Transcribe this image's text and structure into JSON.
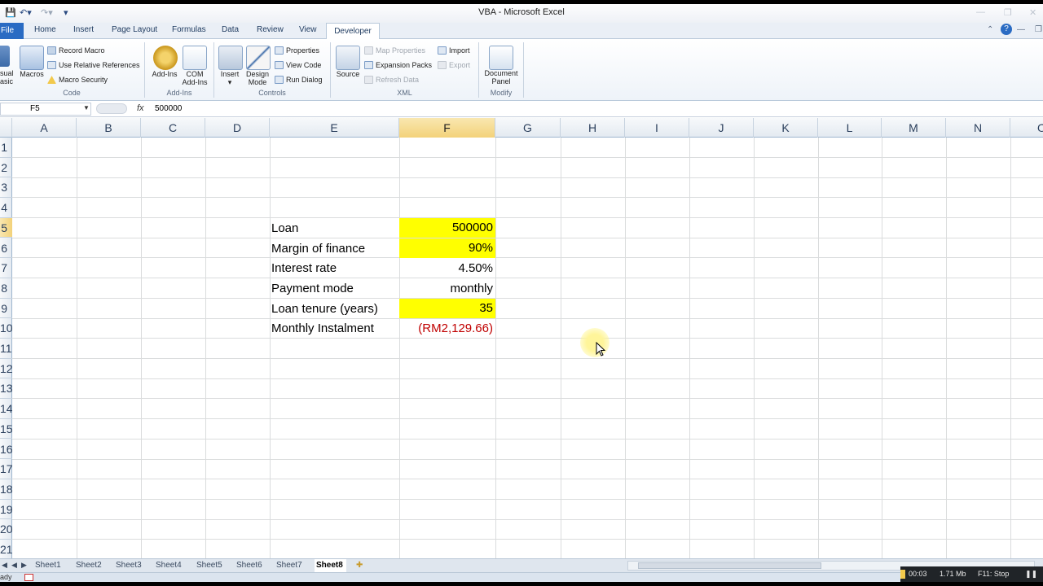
{
  "window": {
    "title": "VBA  -  Microsoft Excel"
  },
  "ribbon_tabs": [
    "File",
    "Home",
    "Insert",
    "Page Layout",
    "Formulas",
    "Data",
    "Review",
    "View",
    "Developer"
  ],
  "active_tab": "Developer",
  "ribbon": {
    "code": {
      "label": "Code",
      "visual_basic_fragment": [
        "sual",
        "asic"
      ],
      "macros": "Macros",
      "record_macro": "Record Macro",
      "use_relative": "Use Relative References",
      "macro_security": "Macro Security"
    },
    "addins": {
      "label": "Add-Ins",
      "addins": "Add-Ins",
      "com_addins_1": "COM",
      "com_addins_2": "Add-Ins"
    },
    "controls": {
      "label": "Controls",
      "insert": "Insert",
      "design_mode_1": "Design",
      "design_mode_2": "Mode",
      "properties": "Properties",
      "view_code": "View Code",
      "run_dialog": "Run Dialog"
    },
    "xml": {
      "label": "XML",
      "source": "Source",
      "map_properties": "Map Properties",
      "expansion_packs": "Expansion Packs",
      "refresh_data": "Refresh Data",
      "import": "Import",
      "export": "Export"
    },
    "modify": {
      "label": "Modify",
      "document_panel_1": "Document",
      "document_panel_2": "Panel"
    }
  },
  "formula_bar": {
    "name_box": "F5",
    "fx": "fx",
    "value": "500000"
  },
  "columns": [
    "A",
    "B",
    "C",
    "D",
    "E",
    "F",
    "G",
    "H",
    "I",
    "J",
    "K",
    "L",
    "M",
    "N",
    "O"
  ],
  "rows": [
    "1",
    "2",
    "3",
    "4",
    "5",
    "6",
    "7",
    "8",
    "9",
    "10",
    "11",
    "12",
    "13",
    "14",
    "15",
    "16",
    "17",
    "18",
    "19",
    "20",
    "21"
  ],
  "cells": {
    "e5": "Loan",
    "f5": "500000",
    "e6": "Margin of finance",
    "f6": "90%",
    "e7": "Interest rate",
    "f7": "4.50%",
    "e8": "Payment mode",
    "f8": "monthly",
    "e9": "Loan tenure (years)",
    "f9": "35",
    "e10": "Monthly Instalment",
    "f10": "(RM2,129.66)"
  },
  "colors": {
    "highlight": "#ffff00",
    "negative": "#c00000",
    "file_tab": "#2a6bc3"
  },
  "sheets": [
    "Sheet1",
    "Sheet2",
    "Sheet3",
    "Sheet4",
    "Sheet5",
    "Sheet6",
    "Sheet7",
    "Sheet8"
  ],
  "active_sheet": "Sheet8",
  "status": {
    "ready": "ady",
    "rec_time": "00:03",
    "rec_size": "1.71 Mb",
    "rec_stop": "F11: Stop"
  }
}
